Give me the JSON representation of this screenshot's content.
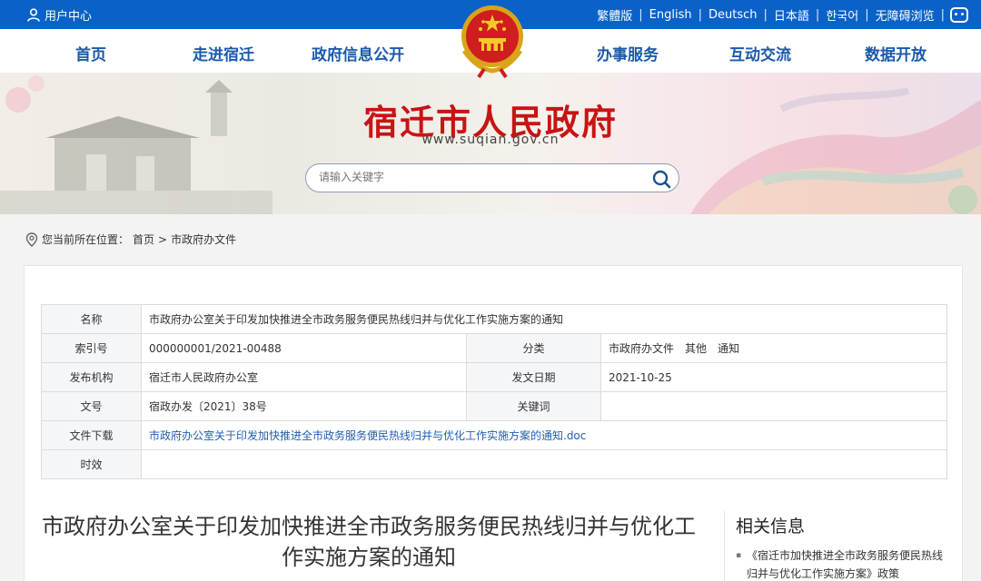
{
  "topbar": {
    "user_center": "用户中心",
    "languages": [
      "繁體版",
      "English",
      "Deutsch",
      "日本語",
      "한국어",
      "无障碍浏览"
    ]
  },
  "nav": {
    "items": [
      "首页",
      "走进宿迁",
      "政府信息公开",
      "办事服务",
      "互动交流",
      "数据开放"
    ]
  },
  "banner": {
    "title": "宿迁市人民政府",
    "url": "www.suqian.gov.cn",
    "search_placeholder": "请输入关键字"
  },
  "breadcrumb": {
    "prefix": "您当前所在位置：",
    "home": "首页",
    "sep": ">",
    "current": "市政府办文件"
  },
  "meta": {
    "name_label": "名称",
    "name_value": "市政府办公室关于印发加快推进全市政务服务便民热线归并与优化工作实施方案的通知",
    "index_label": "索引号",
    "index_value": "000000001/2021-00488",
    "category_label": "分类",
    "category_value": "市政府办文件　其他　通知",
    "publisher_label": "发布机构",
    "publisher_value": "宿迁市人民政府办公室",
    "date_label": "发文日期",
    "date_value": "2021-10-25",
    "docno_label": "文号",
    "docno_value": "宿政办发〔2021〕38号",
    "keywords_label": "关键词",
    "keywords_value": "",
    "download_label": "文件下载",
    "download_value": "市政府办公室关于印发加快推进全市政务服务便民热线归并与优化工作实施方案的通知.doc",
    "validity_label": "时效",
    "validity_value": ""
  },
  "article": {
    "title": "市政府办公室关于印发加快推进全市政务服务便民热线归并与优化工作实施方案的通知"
  },
  "sidebar": {
    "heading": "相关信息",
    "link": "《宿迁市加快推进全市政务服务便民热线归并与优化工作实施方案》政策"
  },
  "colors": {
    "brand_blue": "#0a62c9",
    "title_red": "#c81414",
    "nav_blue": "#1a5aaa"
  }
}
